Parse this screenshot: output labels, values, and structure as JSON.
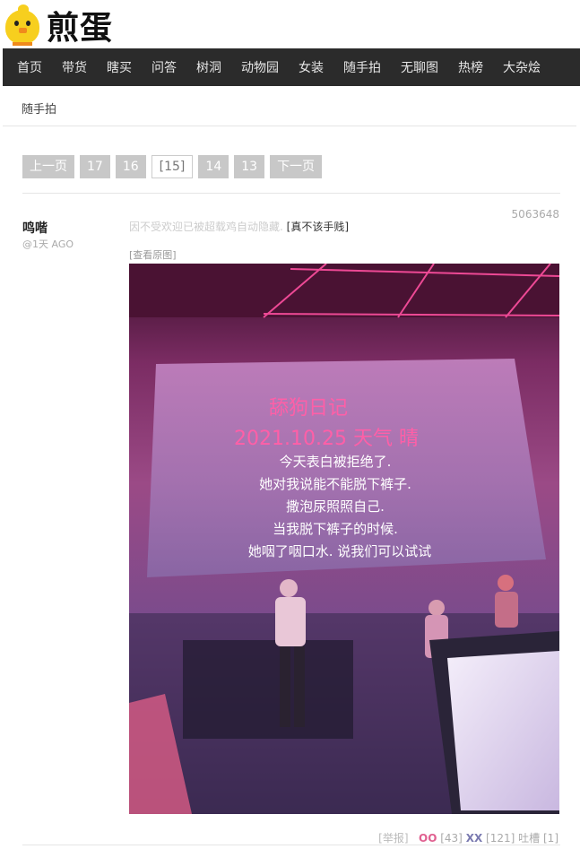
{
  "site": {
    "brand": "煎蛋"
  },
  "nav": [
    "首页",
    "带货",
    "瞎买",
    "问答",
    "树洞",
    "动物园",
    "女装",
    "随手拍",
    "无聊图",
    "热榜",
    "大杂烩"
  ],
  "breadcrumb": "随手拍",
  "pager": {
    "prev": "上一页",
    "pages": [
      "17",
      "16"
    ],
    "current": "[15]",
    "next_pages": [
      "14",
      "13"
    ],
    "next": "下一页"
  },
  "post": {
    "author": "鸣喈",
    "time": "@1天 AGO",
    "id": "5063648",
    "hidden_notice": "因不受欢迎已被超载鸡自动隐藏.",
    "reveal_link": "[真不该手贱]",
    "view_original": "[查看原图]",
    "image_text": {
      "title": "舔狗日记",
      "date": "2021.10.25 天气 晴",
      "lines": [
        "今天表白被拒绝了.",
        "她对我说能不能脱下裤子.",
        "撒泡尿照照自己.",
        "当我脱下裤子的时候.",
        "她咽了咽口水. 说我们可以试试"
      ]
    },
    "actions": {
      "report": "[举报]",
      "oo_label": "OO",
      "oo_count": "[43]",
      "xx_label": "XX",
      "xx_count": "[121]",
      "comment_label": "吐槽",
      "comment_count": "[1]"
    }
  }
}
